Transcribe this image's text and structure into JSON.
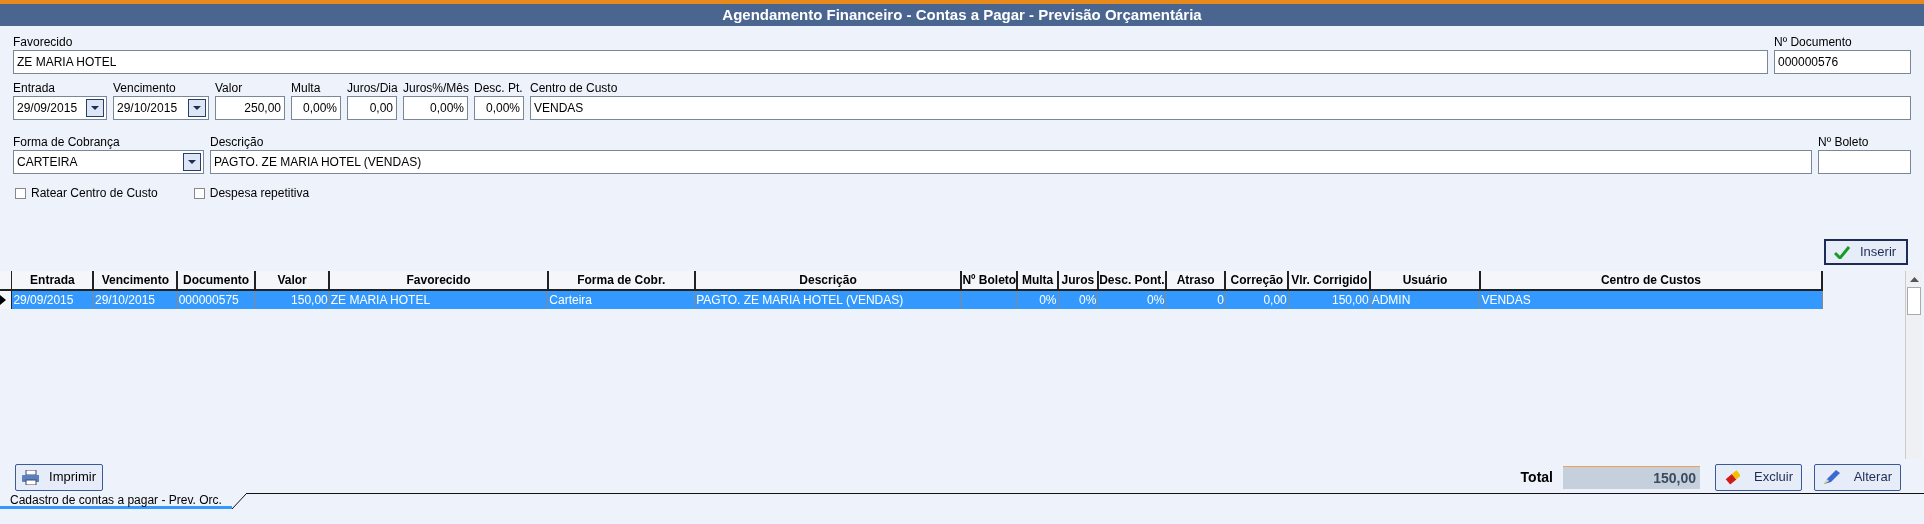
{
  "window": {
    "title": "Agendamento Financeiro - Contas a Pagar - Previsão Orçamentária"
  },
  "form": {
    "fields": [
      {
        "label": "Favorecido",
        "value": "ZE MARIA HOTEL",
        "kind": "text"
      },
      {
        "label": "Nº Documento",
        "value": "000000576",
        "kind": "text"
      },
      {
        "label": "Entrada",
        "value": "29/09/2015",
        "kind": "dropdown"
      },
      {
        "label": "Vencimento",
        "value": "29/10/2015",
        "kind": "dropdown"
      },
      {
        "label": "Valor",
        "value": "250,00",
        "kind": "number"
      },
      {
        "label": "Multa",
        "value": "0,00%",
        "kind": "number"
      },
      {
        "label": "Juros/Dia",
        "value": "0,00",
        "kind": "number"
      },
      {
        "label": "Juros%/Mês",
        "value": "0,00%",
        "kind": "number"
      },
      {
        "label": "Desc. Pt.",
        "value": "0,00%",
        "kind": "number"
      },
      {
        "label": "Centro de Custo",
        "value": "VENDAS",
        "kind": "text"
      },
      {
        "label": "Forma de Cobrança",
        "value": "CARTEIRA",
        "kind": "dropdown"
      },
      {
        "label": "Descrição",
        "value": "PAGTO. ZE MARIA HOTEL (VENDAS)",
        "kind": "text"
      },
      {
        "label": "Nº Boleto",
        "kind": "text"
      }
    ],
    "checkboxes": [
      {
        "label": "Ratear Centro de Custo",
        "checked": false
      },
      {
        "label": "Despesa repetitiva",
        "checked": false
      }
    ]
  },
  "insert_button": "Inserir",
  "table": {
    "columns": [
      "Entrada",
      "Vencimento",
      "Documento",
      "Valor",
      "Favorecido",
      "Forma de Cobr.",
      "Descrição",
      "Nº Boleto",
      "Multa",
      "Juros",
      "Desc. Pont.",
      "Atraso",
      "Correção",
      "Vlr. Corrigido",
      "Usuário",
      "Centro de Custos"
    ],
    "rows": [
      {
        "selected": true,
        "cells": [
          "29/09/2015",
          "29/10/2015",
          "000000575",
          "150,00",
          "ZE MARIA HOTEL",
          "Carteira",
          "PAGTO. ZE MARIA HOTEL (VENDAS)",
          "",
          "0%",
          "0%",
          "0%",
          "0",
          "0,00",
          "150,00",
          "ADMIN",
          "VENDAS"
        ]
      }
    ]
  },
  "print_button": "Imprimir",
  "total": {
    "label": "Total",
    "value": "150,00"
  },
  "buttons": [
    {
      "kind": "delete",
      "label": "Excluir"
    },
    {
      "kind": "edit",
      "label": "Alterar"
    }
  ],
  "tabs": [
    {
      "label": "Cadastro de contas a pagar - Prev. Orc.",
      "selected": true
    }
  ]
}
